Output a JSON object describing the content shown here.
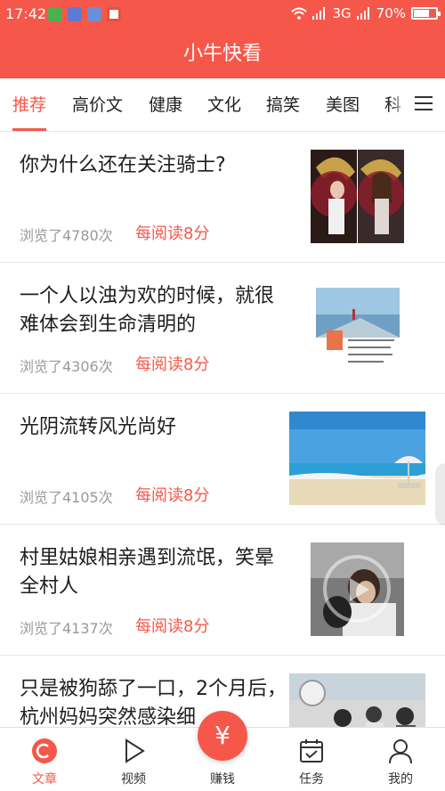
{
  "status_bar": {
    "time": "17:42",
    "network": "3G",
    "battery": "70%",
    "battery_level": 0.7
  },
  "header": {
    "title": "小牛快看"
  },
  "tabs": [
    {
      "label": "推荐",
      "active": true
    },
    {
      "label": "高价文"
    },
    {
      "label": "健康"
    },
    {
      "label": "文化"
    },
    {
      "label": "搞笑"
    },
    {
      "label": "美图"
    },
    {
      "label": "科"
    }
  ],
  "articles": [
    {
      "title": "你为什么还在关注骑士?",
      "views": "浏览了4780次",
      "reward": "每阅读8分"
    },
    {
      "title": "一个人以浊为欢的时候，就很难体会到生命清明的",
      "views": "浏览了4306次",
      "reward": "每阅读8分"
    },
    {
      "title": "光阴流转风光尚好",
      "views": "浏览了4105次",
      "reward": "每阅读8分"
    },
    {
      "title": "村里姑娘相亲遇到流氓，笑晕全村人",
      "views": "浏览了4137次",
      "reward": "每阅读8分"
    },
    {
      "title": "只是被狗舔了一口，2个月后，杭州妈妈突然感染细"
    }
  ],
  "bottom_nav": [
    {
      "label": "文章",
      "icon": "article-icon",
      "active": true
    },
    {
      "label": "视频",
      "icon": "play-icon"
    },
    {
      "label": "赚钱",
      "icon": "yuan-icon",
      "symbol": "¥"
    },
    {
      "label": "任务",
      "icon": "calendar-check-icon"
    },
    {
      "label": "我的",
      "icon": "user-icon"
    }
  ],
  "colors": {
    "accent": "#f5584a",
    "text": "#222222",
    "muted": "#999999"
  }
}
